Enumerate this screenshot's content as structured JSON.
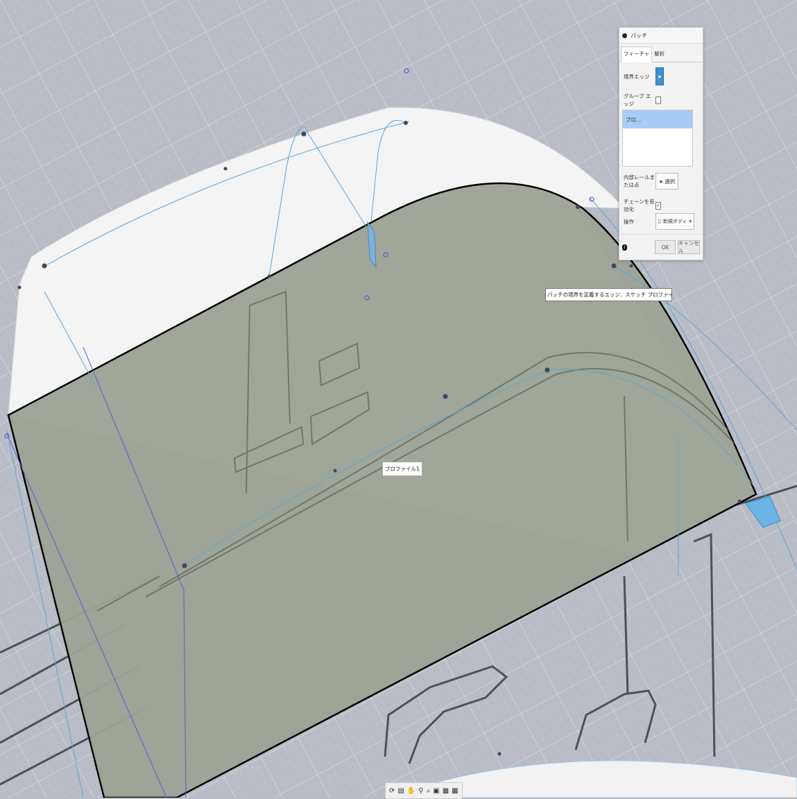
{
  "dialog": {
    "title": "パッチ",
    "tabs": [
      {
        "label": "フィーチャ",
        "active": true
      },
      {
        "label": "解析",
        "active": false
      }
    ],
    "boundary_edges_label": "境界エッジ",
    "group_edges_label": "グループ エッジ",
    "list_item": "プロ...",
    "interior_rails_label": "内部レールまたは点",
    "select_label": "選択",
    "enable_chaining_label": "チェーンを有効化",
    "operation_label": "操作",
    "operation_value": "新規ボディ",
    "ok_label": "OK",
    "cancel_label": "キャンセル"
  },
  "tooltip": "パッチの境界を定義するエッジ、スケッチ プロファイル、またはスケッチ曲線を選択",
  "profile_label": "プロファイル1",
  "navbar_icons": [
    "orbit-icon",
    "pan-look-icon",
    "hand-icon",
    "zoom-icon",
    "zoom-window-icon",
    "display-mode-icon",
    "visual-style-icon",
    "grid-icon"
  ],
  "colors": {
    "accent": "#3d8fd1",
    "selection": "#a7ccf5",
    "patch_fill": "#9ca295",
    "background": "#b9bcc4"
  }
}
